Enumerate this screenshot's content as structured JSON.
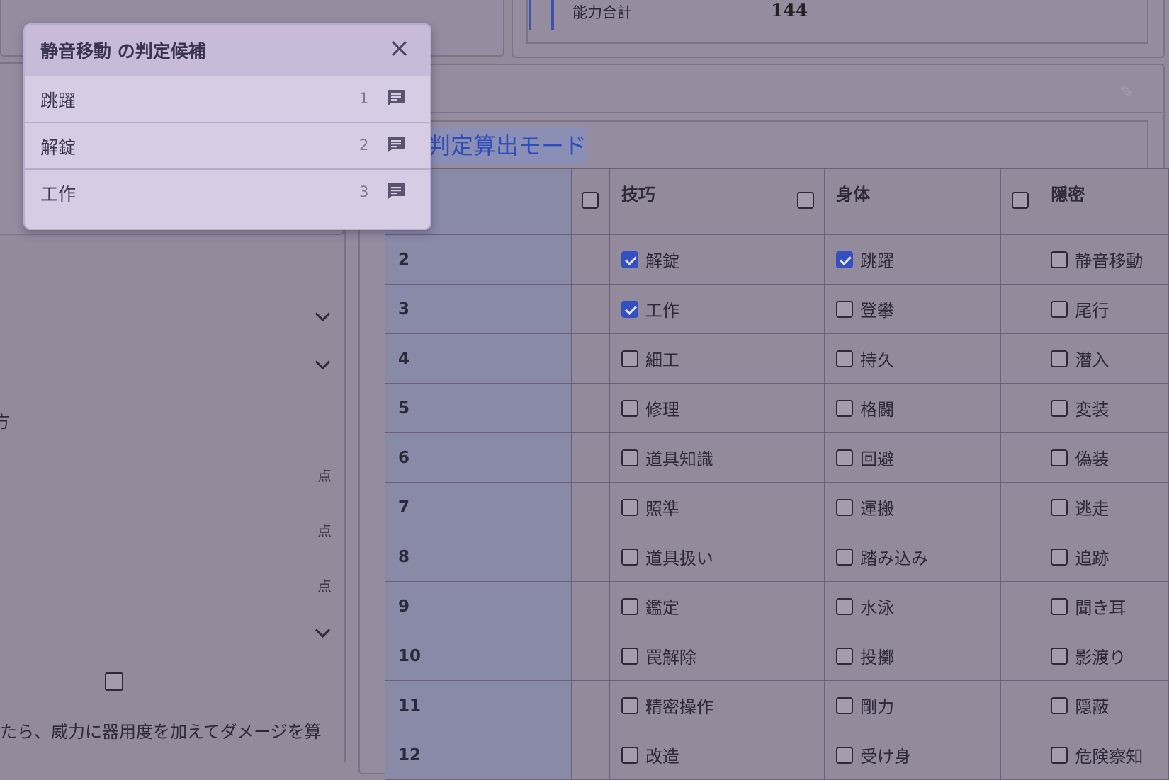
{
  "stats": {
    "label": "能力合計",
    "value": "144"
  },
  "mode": {
    "label": "判定算出モード"
  },
  "left": {
    "fragment_char": "方",
    "unit_points": [
      "点",
      "点",
      "点"
    ],
    "bottom_text": "たら、威力に器用度を加えてダメージを算"
  },
  "popup": {
    "title": "静音移動 の判定候補",
    "items": [
      {
        "label": "跳躍",
        "num": "1"
      },
      {
        "label": "解錠",
        "num": "2"
      },
      {
        "label": "工作",
        "num": "3"
      }
    ]
  },
  "table": {
    "headers": [
      "技巧",
      "身体",
      "隠密"
    ],
    "rows": [
      {
        "num": "2",
        "cells": [
          {
            "label": "解錠",
            "checked": true
          },
          {
            "label": "跳躍",
            "checked": true
          },
          {
            "label": "静音移動",
            "checked": false
          }
        ]
      },
      {
        "num": "3",
        "cells": [
          {
            "label": "工作",
            "checked": true
          },
          {
            "label": "登攀",
            "checked": false
          },
          {
            "label": "尾行",
            "checked": false
          }
        ]
      },
      {
        "num": "4",
        "cells": [
          {
            "label": "細工",
            "checked": false
          },
          {
            "label": "持久",
            "checked": false
          },
          {
            "label": "潜入",
            "checked": false
          }
        ]
      },
      {
        "num": "5",
        "cells": [
          {
            "label": "修理",
            "checked": false
          },
          {
            "label": "格闘",
            "checked": false
          },
          {
            "label": "変装",
            "checked": false
          }
        ]
      },
      {
        "num": "6",
        "cells": [
          {
            "label": "道具知識",
            "checked": false
          },
          {
            "label": "回避",
            "checked": false
          },
          {
            "label": "偽装",
            "checked": false
          }
        ]
      },
      {
        "num": "7",
        "cells": [
          {
            "label": "照準",
            "checked": false
          },
          {
            "label": "運搬",
            "checked": false
          },
          {
            "label": "逃走",
            "checked": false
          }
        ]
      },
      {
        "num": "8",
        "cells": [
          {
            "label": "道具扱い",
            "checked": false
          },
          {
            "label": "踏み込み",
            "checked": false
          },
          {
            "label": "追跡",
            "checked": false
          }
        ]
      },
      {
        "num": "9",
        "cells": [
          {
            "label": "鑑定",
            "checked": false
          },
          {
            "label": "水泳",
            "checked": false
          },
          {
            "label": "聞き耳",
            "checked": false
          }
        ]
      },
      {
        "num": "10",
        "cells": [
          {
            "label": "罠解除",
            "checked": false
          },
          {
            "label": "投擲",
            "checked": false
          },
          {
            "label": "影渡り",
            "checked": false
          }
        ]
      },
      {
        "num": "11",
        "cells": [
          {
            "label": "精密操作",
            "checked": false
          },
          {
            "label": "剛力",
            "checked": false
          },
          {
            "label": "隠蔽",
            "checked": false
          }
        ]
      },
      {
        "num": "12",
        "cells": [
          {
            "label": "改造",
            "checked": false
          },
          {
            "label": "受け身",
            "checked": false
          },
          {
            "label": "危険察知",
            "checked": false
          }
        ]
      }
    ]
  },
  "colors": {
    "checked": "#3450c0",
    "overlay": "#938a9c",
    "popup_bg": "#d6cce3"
  }
}
